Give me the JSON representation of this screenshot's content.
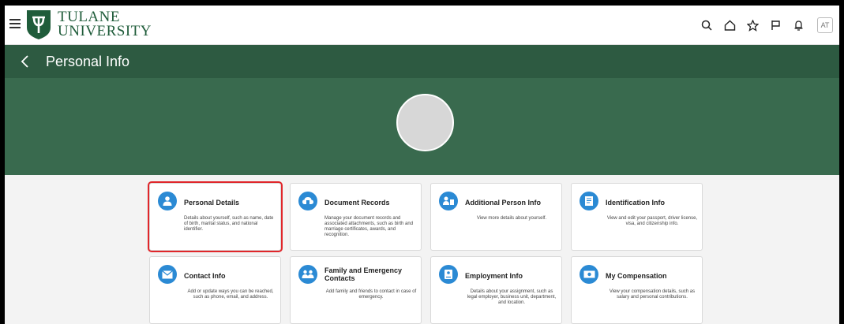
{
  "header": {
    "logo_line1": "TULANE",
    "logo_line2": "UNIVERSITY",
    "avatar_initials": "AT",
    "icons": [
      "search-icon",
      "home-icon",
      "star-icon",
      "flag-icon",
      "bell-icon"
    ]
  },
  "page": {
    "title": "Personal Info"
  },
  "colors": {
    "brand_green": "#2d5a41",
    "hero_green": "#396a4e",
    "card_icon_blue": "#2b8ad4",
    "selection_red": "#e0262a"
  },
  "cards": [
    {
      "title": "Personal Details",
      "desc": "Details about yourself, such as name, date of birth, marital status, and national identifier.",
      "icon": "person-icon",
      "selected": true
    },
    {
      "title": "Document Records",
      "desc": "Manage your document records and associated attachments, such as birth and marriage certificates, awards, and recognition.",
      "icon": "cloud-document-icon",
      "selected": false
    },
    {
      "title": "Additional Person Info",
      "desc": "View more details about yourself.",
      "icon": "person-card-icon",
      "selected": false
    },
    {
      "title": "Identification Info",
      "desc": "View and edit your passport, driver license, visa, and citizenship info.",
      "icon": "id-document-icon",
      "selected": false
    },
    {
      "title": "Contact Info",
      "desc": "Add or update ways you can be reached, such as phone, email, and address.",
      "icon": "envelope-icon",
      "selected": false
    },
    {
      "title": "Family and Emergency Contacts",
      "desc": "Add family and friends to contact in case of emergency.",
      "icon": "family-icon",
      "selected": false
    },
    {
      "title": "Employment Info",
      "desc": "Details about your assignment, such as legal employer, business unit, department, and location.",
      "icon": "badge-icon",
      "selected": false
    },
    {
      "title": "My Compensation",
      "desc": "View your compensation details, such as salary and personal contributions.",
      "icon": "money-icon",
      "selected": false
    }
  ]
}
